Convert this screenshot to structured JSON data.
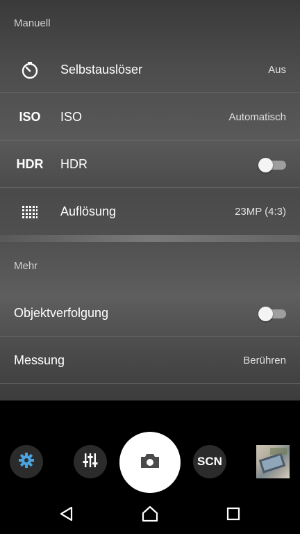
{
  "sections": {
    "manual": "Manuell",
    "more": "Mehr"
  },
  "rows": {
    "self_timer": {
      "label": "Selbstauslöser",
      "value": "Aus",
      "icon": "timer-icon"
    },
    "iso": {
      "icon_text": "ISO",
      "label": "ISO",
      "value": "Automatisch"
    },
    "hdr": {
      "icon_text": "HDR",
      "label": "HDR",
      "toggle": "off"
    },
    "resolution": {
      "label": "Auflösung",
      "value": "23MP (4:3)",
      "icon": "grid-dots-icon"
    },
    "object_tracking": {
      "label": "Objektverfolgung",
      "toggle": "off"
    },
    "metering": {
      "label": "Messung",
      "value": "Berühren"
    }
  },
  "camera_bar": {
    "settings_icon": "gear-icon",
    "manual_icon": "sliders-icon",
    "shutter_icon": "camera-icon",
    "scene_label": "SCN",
    "accent": "#4aa3df"
  },
  "nav": {
    "back_icon": "back-triangle-icon",
    "home_icon": "home-icon",
    "recents_icon": "recents-square-icon"
  }
}
